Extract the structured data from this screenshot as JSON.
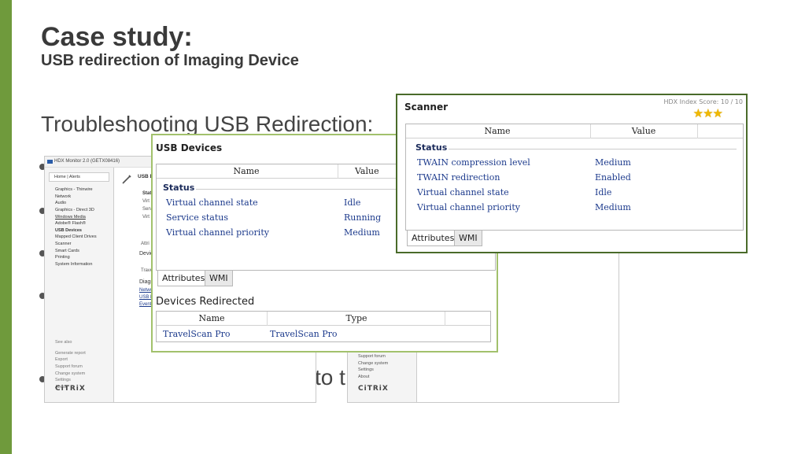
{
  "slide": {
    "title": "Case study:",
    "subtitle": "USB redirection of Imaging Device",
    "section_heading": "Troubleshooting USB Redirection:",
    "partial_text_tail": "to t"
  },
  "hdx_monitor": {
    "title": "HDX Monitor 2.0 (GETX08416)",
    "home": "Home | Alerts",
    "nav": [
      "Graphics - Thinwire",
      "Network",
      "Audio",
      "Graphics - Direct 3D",
      "Windows Media",
      "Adobe® Flash®",
      "USB Devices",
      "Mapped Client Drives",
      "Scanner",
      "Smart Cards",
      "Printing",
      "System Information"
    ],
    "see_also_label": "See also",
    "see_also": [
      "Generate report",
      "Export",
      "Support forum",
      "Change system",
      "Settings",
      "About"
    ],
    "logo": "CiTRiX",
    "content_heading": "USB D",
    "content_status": "Stat",
    "content_rows": [
      "Virt",
      "Serv",
      "Virt"
    ],
    "content_attr": "Attri",
    "content_devices": "Devic",
    "content_trave": "Trave",
    "content_diag": "Diagn",
    "content_links": [
      "Netwo",
      "USB R",
      "Event"
    ]
  },
  "hdx_monitor_2": {
    "see_also": [
      "Support forum",
      "Change system",
      "Settings",
      "About"
    ],
    "logo": "CiTRiX"
  },
  "usb_dialog": {
    "title": "USB Devices",
    "col_name": "Name",
    "col_value": "Value",
    "group": "Status",
    "rows": [
      {
        "name": "Virtual channel state",
        "value": "Idle"
      },
      {
        "name": "Service status",
        "value": "Running"
      },
      {
        "name": "Virtual channel priority",
        "value": "Medium"
      }
    ],
    "tab_attributes": "Attributes",
    "tab_wmi": "WMI",
    "devices_heading": "Devices Redirected",
    "dev_col_name": "Name",
    "dev_col_type": "Type",
    "device": {
      "name": "TravelScan Pro",
      "type": "TravelScan Pro"
    }
  },
  "scanner_dialog": {
    "title": "Scanner",
    "hdx_score": "HDX Index Score: 10 / 10",
    "stars": "★★★",
    "col_name": "Name",
    "col_value": "Value",
    "group": "Status",
    "rows": [
      {
        "name": "TWAIN compression level",
        "value": "Medium"
      },
      {
        "name": "TWAIN redirection",
        "value": "Enabled"
      },
      {
        "name": "Virtual channel state",
        "value": "Idle"
      },
      {
        "name": "Virtual channel priority",
        "value": "Medium"
      }
    ],
    "tab_attributes": "Attributes",
    "tab_wmi": "WMI"
  },
  "colors": {
    "accent_green": "#6f9a3c",
    "dialog_border_light": "#a2c16c",
    "dialog_border_dark": "#4a6b2a",
    "value_blue": "#1c3a8c"
  }
}
